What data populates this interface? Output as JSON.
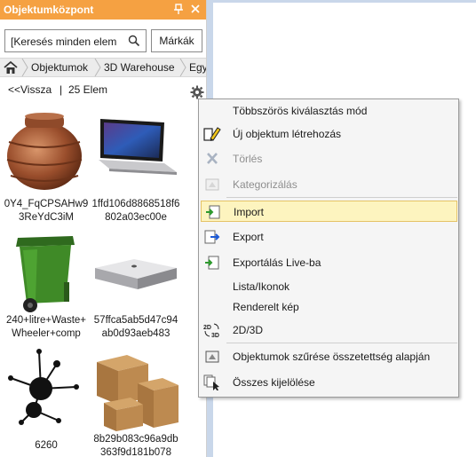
{
  "panel": {
    "title": "Objektumközpont",
    "pin_glyph": "📌",
    "close_glyph": "✕"
  },
  "search": {
    "value": "[Keresés minden elem",
    "icon": "search-icon"
  },
  "brands_button": "Márkák",
  "breadcrumb": {
    "home_icon": "home-icon",
    "items": [
      "Objektumok",
      "3D Warehouse",
      "Egy"
    ]
  },
  "nav": {
    "back": "<<Vissza",
    "separator": "|",
    "count": "25 Elem",
    "settings_icon": "gear-icon"
  },
  "items": [
    {
      "caption": "0Y4_FqCPSAHw93ReYdC3iM",
      "thumbnail": "copper-pot"
    },
    {
      "caption": "1ffd106d8868518f6802a03ec00e",
      "thumbnail": "laptop"
    },
    {
      "caption": "240+litre+Waste+Wheeler+comp",
      "thumbnail": "green-wheelie-bin"
    },
    {
      "caption": "57ffca5ab5d47c94ab0d93aeb483",
      "thumbnail": "mini-computer"
    },
    {
      "caption": "6260",
      "thumbnail": "molecule"
    },
    {
      "caption": "8b29b083c96a9db363f9d181b078",
      "thumbnail": "cardboard-boxes"
    }
  ],
  "context_menu": {
    "items": [
      {
        "label": "Többszörös kiválasztás mód",
        "icon": "",
        "disabled": false
      },
      {
        "label": "Új objektum létrehozás",
        "icon": "pencil-icon",
        "disabled": false
      },
      {
        "label": "Törlés",
        "icon": "delete-x-icon",
        "disabled": true
      },
      {
        "label": "Kategorizálás",
        "icon": "categorize-icon",
        "disabled": true
      },
      {
        "label": "Import",
        "icon": "import-icon",
        "disabled": false,
        "highlighted": true
      },
      {
        "label": "Export",
        "icon": "export-icon",
        "disabled": false
      },
      {
        "label": "Exportálás Live-ba",
        "icon": "export-live-icon",
        "disabled": false
      },
      {
        "label": "Lista/Ikonok",
        "icon": "",
        "disabled": false
      },
      {
        "label": "Renderelt kép",
        "icon": "",
        "disabled": false
      },
      {
        "label": "2D/3D",
        "icon": "2d-3d-icon",
        "disabled": false
      },
      {
        "label": "Objektumok szűrése összetettség alapján",
        "icon": "filter-complexity-icon",
        "disabled": false
      },
      {
        "label": "Összes kijelölése",
        "icon": "select-all-icon",
        "disabled": false
      }
    ]
  },
  "colors": {
    "titlebar": "#f5a142",
    "highlight": "#fdf4bf",
    "highlight_border": "#e5c365",
    "viewport_border": "#c9d7ea"
  }
}
